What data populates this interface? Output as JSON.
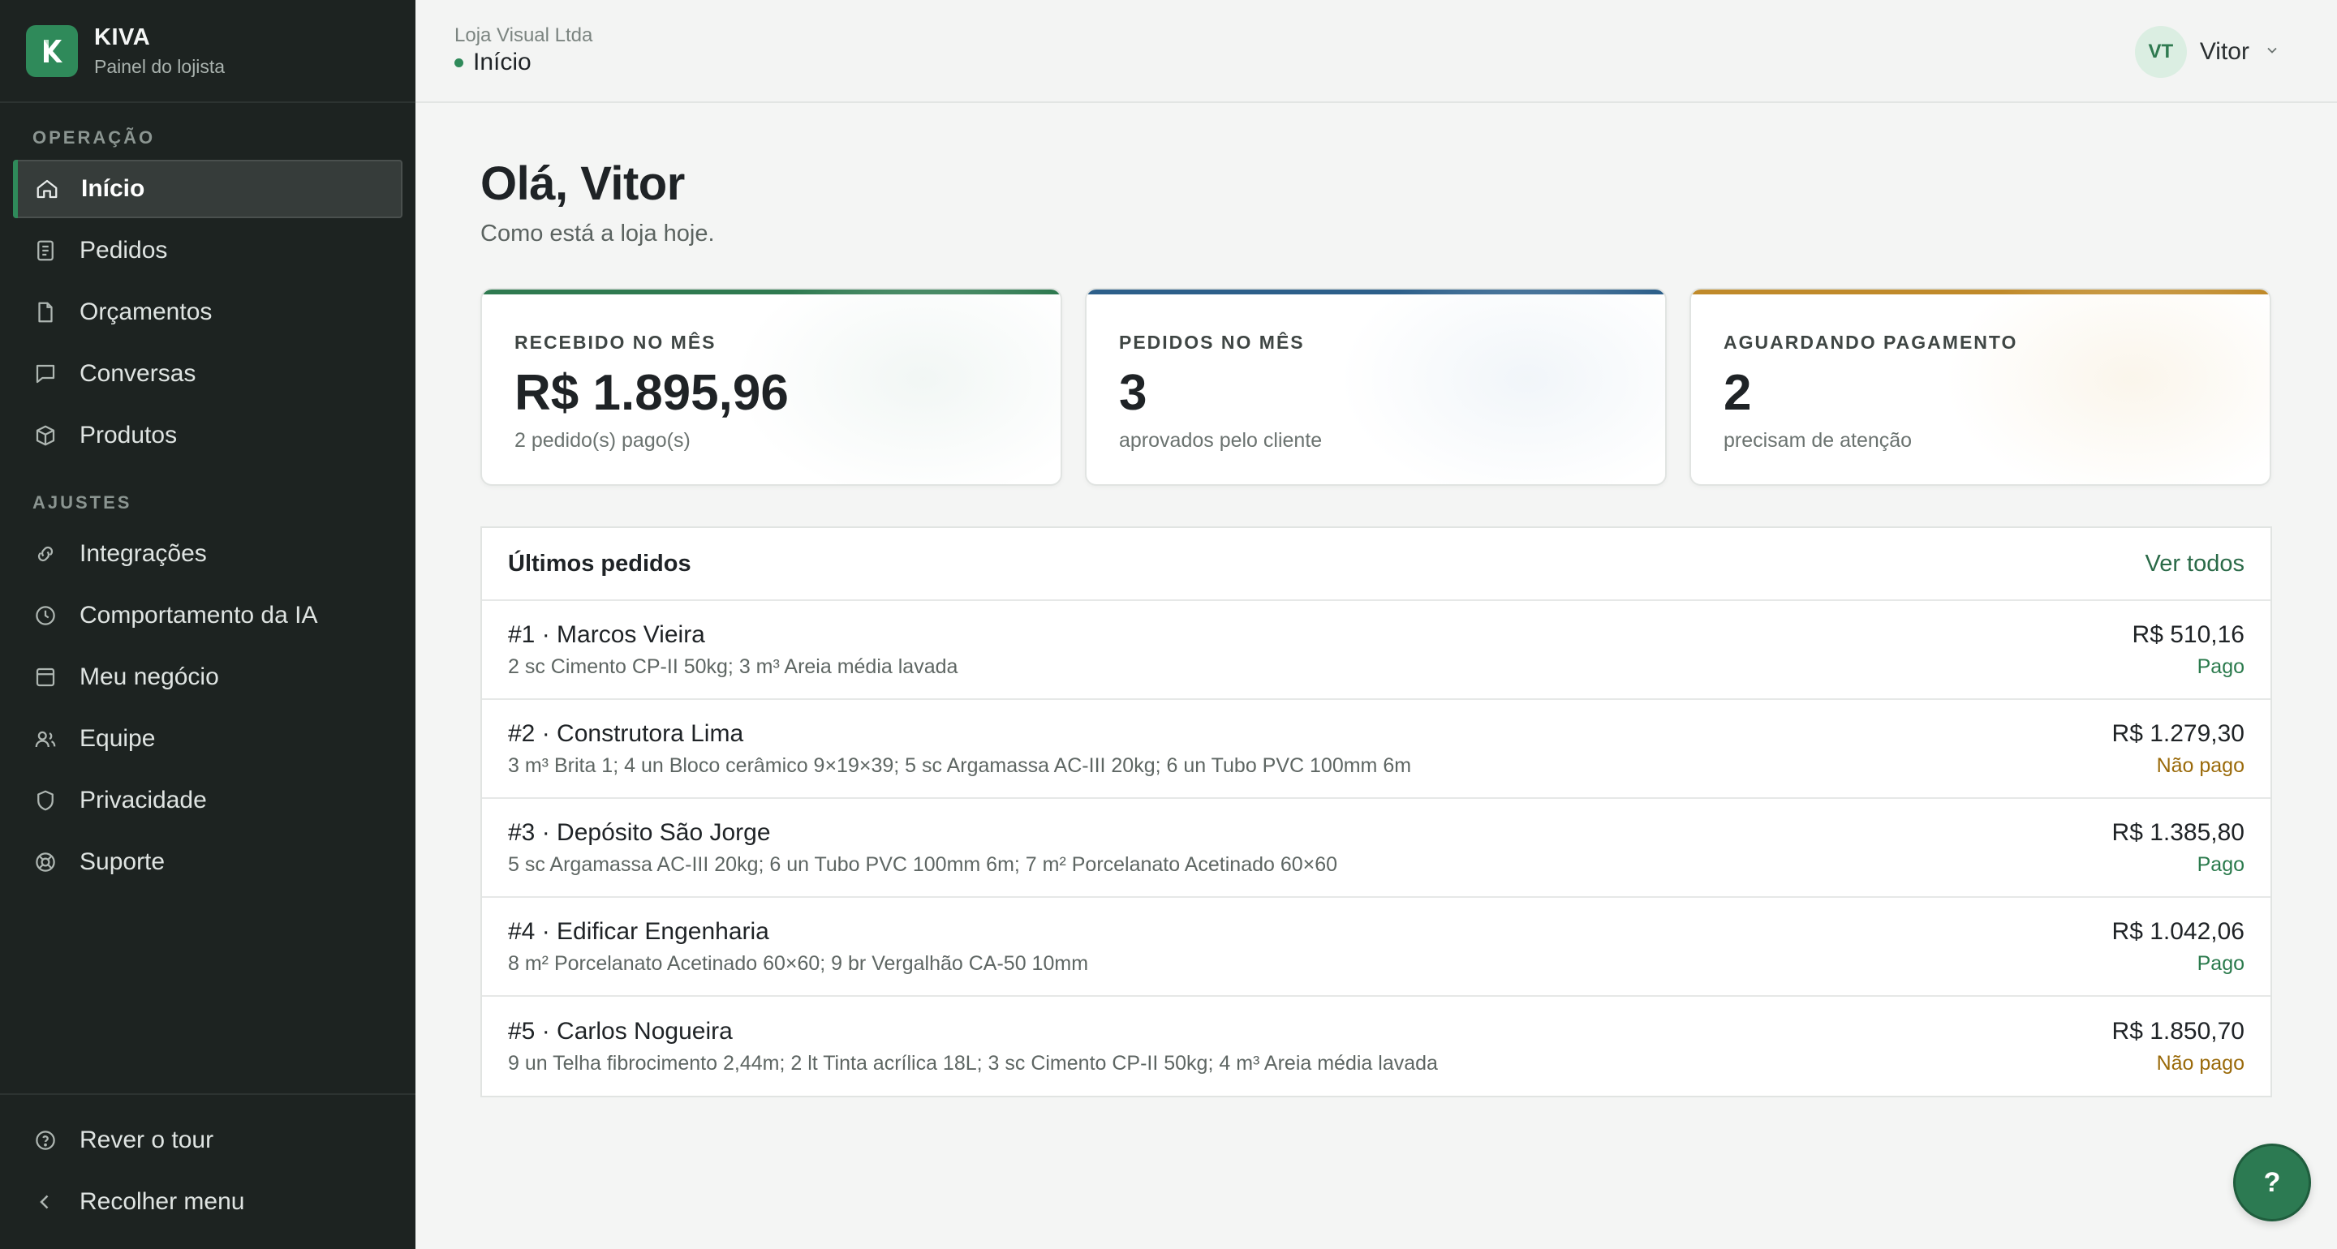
{
  "brand": {
    "name": "KIVA",
    "subtitle": "Painel do lojista"
  },
  "sidebar": {
    "section_operacao": "OPERAÇÃO",
    "section_ajustes": "AJUSTES",
    "items": [
      {
        "label": "Início",
        "icon": "home-icon"
      },
      {
        "label": "Pedidos",
        "icon": "document-list-icon"
      },
      {
        "label": "Orçamentos",
        "icon": "file-icon"
      },
      {
        "label": "Conversas",
        "icon": "chat-icon"
      },
      {
        "label": "Produtos",
        "icon": "box-icon"
      },
      {
        "label": "Integrações",
        "icon": "link-icon"
      },
      {
        "label": "Comportamento da IA",
        "icon": "clock-icon"
      },
      {
        "label": "Meu negócio",
        "icon": "store-icon"
      },
      {
        "label": "Equipe",
        "icon": "users-icon"
      },
      {
        "label": "Privacidade",
        "icon": "shield-icon"
      },
      {
        "label": "Suporte",
        "icon": "lifebuoy-icon"
      }
    ],
    "bottom": [
      {
        "label": "Rever o tour",
        "icon": "help-circle-icon"
      },
      {
        "label": "Recolher menu",
        "icon": "chevron-left-icon"
      }
    ]
  },
  "header": {
    "company": "Loja Visual Ltda",
    "page": "Início",
    "user_initials": "VT",
    "user_name": "Vitor"
  },
  "main": {
    "greeting": "Olá, Vitor",
    "subtitle": "Como está a loja hoje.",
    "cards": [
      {
        "label": "RECEBIDO NO MÊS",
        "value": "R$ 1.895,96",
        "note": "2 pedido(s) pago(s)",
        "accent": "#2f7a50"
      },
      {
        "label": "PEDIDOS NO MÊS",
        "value": "3",
        "note": "aprovados pelo cliente",
        "accent": "#2d5f8a"
      },
      {
        "label": "AGUARDANDO PAGAMENTO",
        "value": "2",
        "note": "precisam de atenção",
        "accent": "#c08a2a"
      }
    ],
    "orders": {
      "title": "Últimos pedidos",
      "link": "Ver todos",
      "rows": [
        {
          "title": "#1 · Marcos Vieira",
          "items": "2 sc Cimento CP-II 50kg; 3 m³ Areia média lavada",
          "amount": "R$ 510,16",
          "status": "Pago",
          "paid": true
        },
        {
          "title": "#2 · Construtora Lima",
          "items": "3 m³ Brita 1; 4 un Bloco cerâmico 9×19×39; 5 sc Argamassa AC-III 20kg; 6 un Tubo PVC 100mm 6m",
          "amount": "R$ 1.279,30",
          "status": "Não pago",
          "paid": false
        },
        {
          "title": "#3 · Depósito São Jorge",
          "items": "5 sc Argamassa AC-III 20kg; 6 un Tubo PVC 100mm 6m; 7 m² Porcelanato Acetinado 60×60",
          "amount": "R$ 1.385,80",
          "status": "Pago",
          "paid": true
        },
        {
          "title": "#4 · Edificar Engenharia",
          "items": "8 m² Porcelanato Acetinado 60×60; 9 br Vergalhão CA-50 10mm",
          "amount": "R$ 1.042,06",
          "status": "Pago",
          "paid": true
        },
        {
          "title": "#5 · Carlos Nogueira",
          "items": "9 un Telha fibrocimento 2,44m; 2 lt Tinta acrílica 18L; 3 sc Cimento CP-II 50kg; 4 m³ Areia média lavada",
          "amount": "R$ 1.850,70",
          "status": "Não pago",
          "paid": false
        }
      ]
    }
  },
  "help_button": "?"
}
